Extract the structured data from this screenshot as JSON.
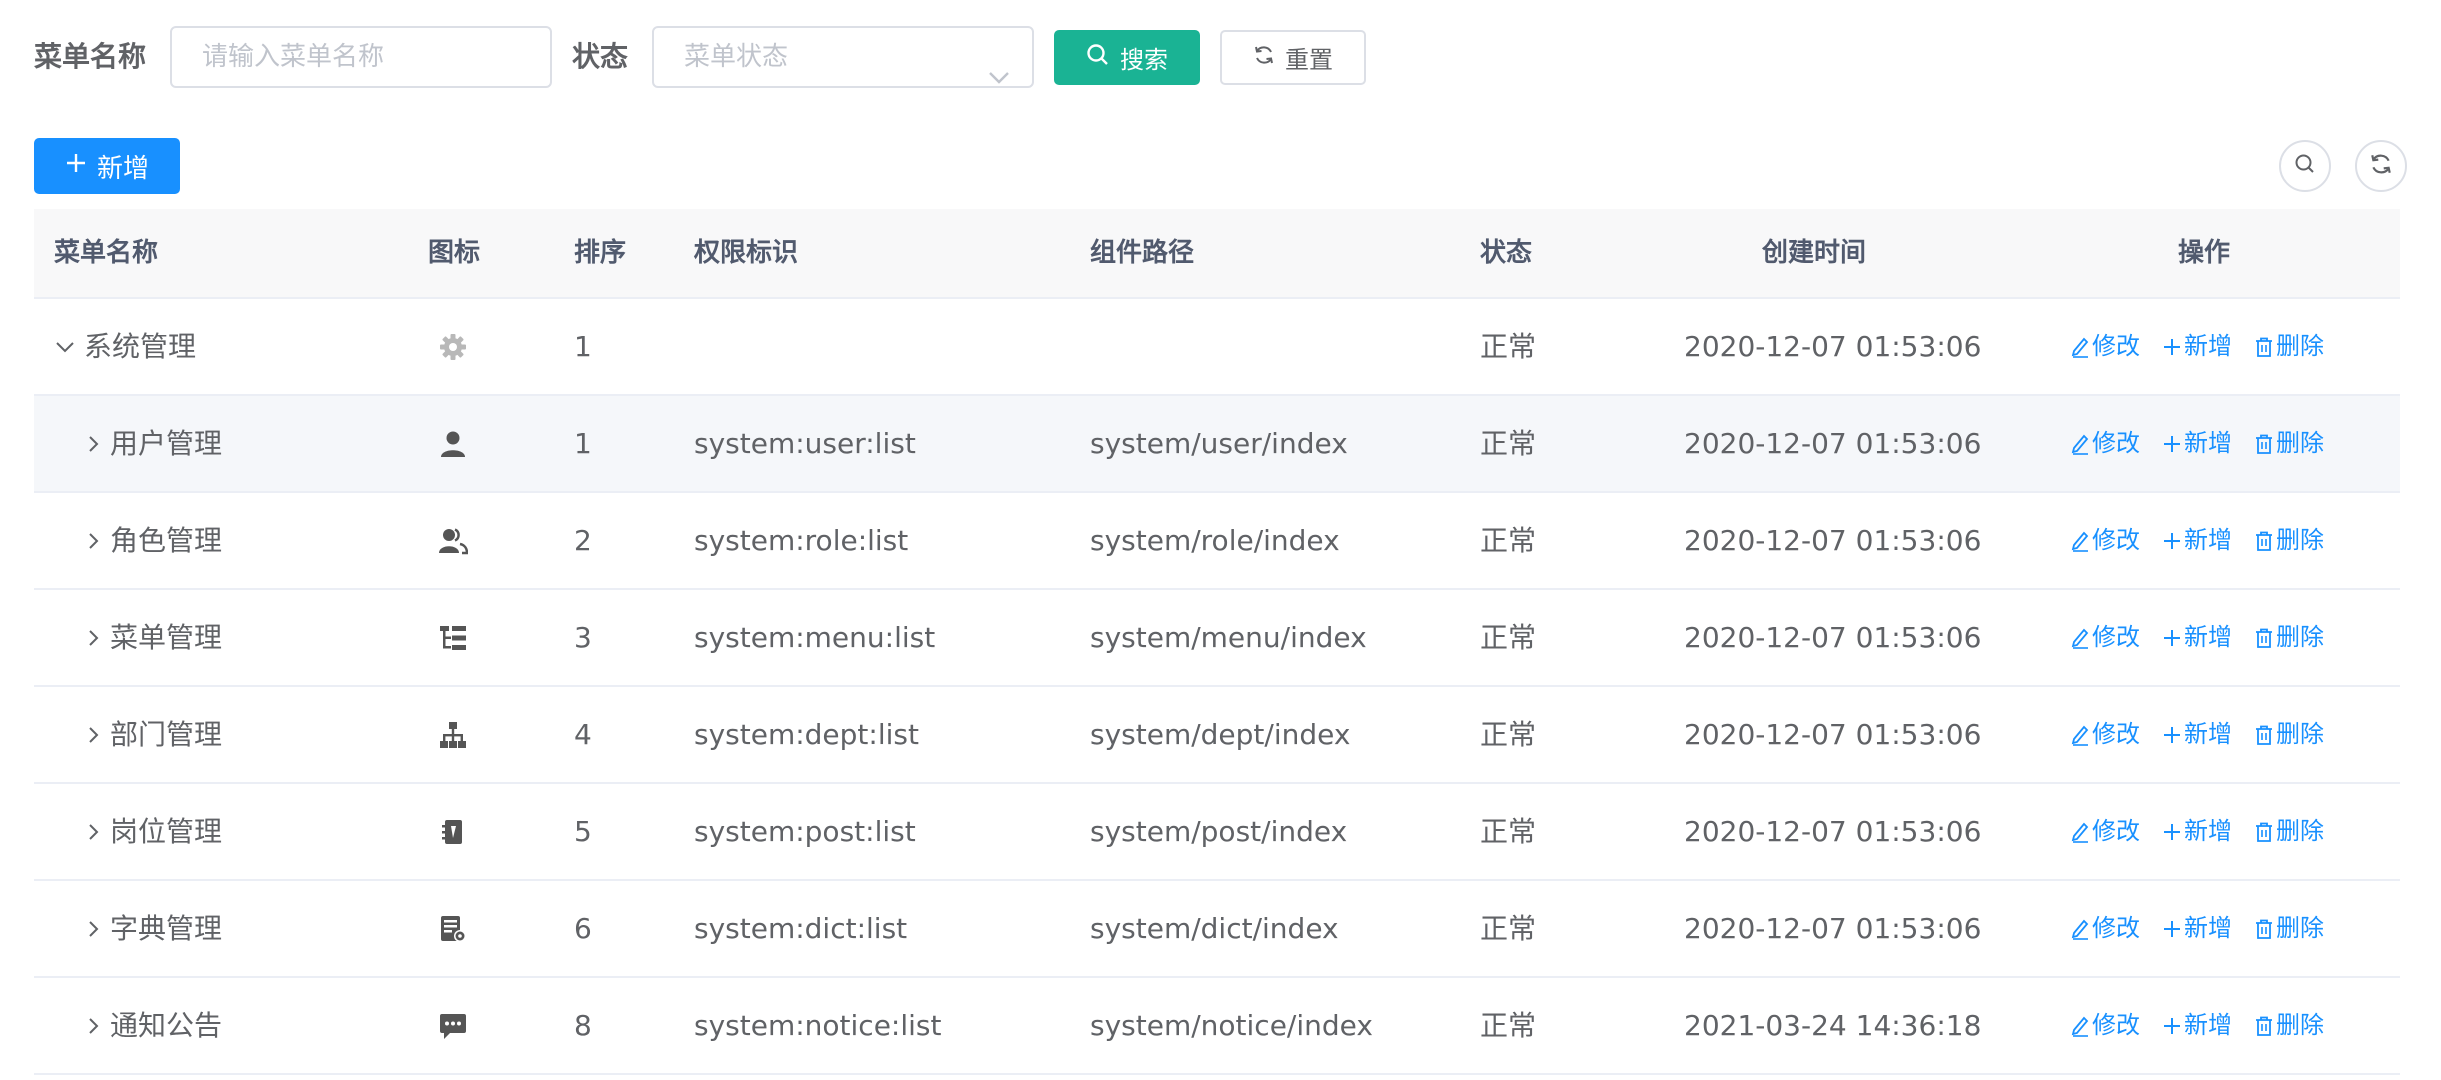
{
  "search": {
    "menu_name_label": "菜单名称",
    "menu_name_placeholder": "请输入菜单名称",
    "status_label": "状态",
    "status_placeholder": "菜单状态",
    "search_button": "搜索",
    "reset_button": "重置"
  },
  "toolbar": {
    "add_button": "新增"
  },
  "table": {
    "columns": [
      "菜单名称",
      "图标",
      "排序",
      "权限标识",
      "组件路径",
      "状态",
      "创建时间",
      "操作"
    ],
    "actions": {
      "edit": "修改",
      "add": "新增",
      "delete": "删除"
    },
    "rows": [
      {
        "name": "系统管理",
        "icon": "gear-icon",
        "order": "1",
        "perms": "",
        "component": "",
        "status": "正常",
        "created": "2020-12-07 01:53:06"
      },
      {
        "name": "用户管理",
        "icon": "user-icon",
        "order": "1",
        "perms": "system:user:list",
        "component": "system/user/index",
        "status": "正常",
        "created": "2020-12-07 01:53:06"
      },
      {
        "name": "角色管理",
        "icon": "peoples-icon",
        "order": "2",
        "perms": "system:role:list",
        "component": "system/role/index",
        "status": "正常",
        "created": "2020-12-07 01:53:06"
      },
      {
        "name": "菜单管理",
        "icon": "tree-table-icon",
        "order": "3",
        "perms": "system:menu:list",
        "component": "system/menu/index",
        "status": "正常",
        "created": "2020-12-07 01:53:06"
      },
      {
        "name": "部门管理",
        "icon": "tree-icon",
        "order": "4",
        "perms": "system:dept:list",
        "component": "system/dept/index",
        "status": "正常",
        "created": "2020-12-07 01:53:06"
      },
      {
        "name": "岗位管理",
        "icon": "post-icon",
        "order": "5",
        "perms": "system:post:list",
        "component": "system/post/index",
        "status": "正常",
        "created": "2020-12-07 01:53:06"
      },
      {
        "name": "字典管理",
        "icon": "dict-icon",
        "order": "6",
        "perms": "system:dict:list",
        "component": "system/dict/index",
        "status": "正常",
        "created": "2020-12-07 01:53:06"
      },
      {
        "name": "通知公告",
        "icon": "message-icon",
        "order": "8",
        "perms": "system:notice:list",
        "component": "system/notice/index",
        "status": "正常",
        "created": "2021-03-24 14:36:18"
      }
    ]
  }
}
